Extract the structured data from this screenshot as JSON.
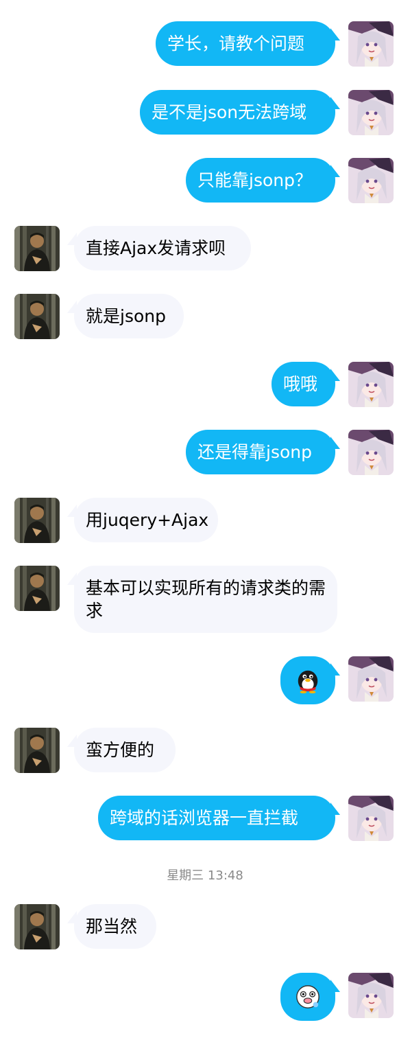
{
  "messages": [
    {
      "side": "out",
      "text": "学长，请教个问题"
    },
    {
      "side": "out",
      "text": "是不是json无法跨域"
    },
    {
      "side": "out",
      "text": "只能靠jsonp？"
    },
    {
      "side": "in",
      "text": "直接Ajax发请求呗"
    },
    {
      "side": "in",
      "text": "就是jsonp"
    },
    {
      "side": "out",
      "text": "哦哦"
    },
    {
      "side": "out",
      "text": "还是得靠jsonp"
    },
    {
      "side": "in",
      "text": "用juqery+Ajax"
    },
    {
      "side": "in",
      "text": "基本可以实现所有的请求类的需求"
    },
    {
      "side": "out",
      "emoji": "penguin-sticker-icon"
    },
    {
      "side": "in",
      "text": "蛮方便的"
    },
    {
      "side": "out",
      "text": "跨域的话浏览器一直拦截"
    },
    {
      "side": "in",
      "text": "那当然"
    },
    {
      "side": "out",
      "emoji": "penguin-face-sticker-icon"
    }
  ],
  "timestamp": "星期三 13:48",
  "colors": {
    "outgoing_bubble": "#12b7f5",
    "incoming_bubble": "#f5f6fc",
    "timestamp_text": "#8a8a8a"
  }
}
